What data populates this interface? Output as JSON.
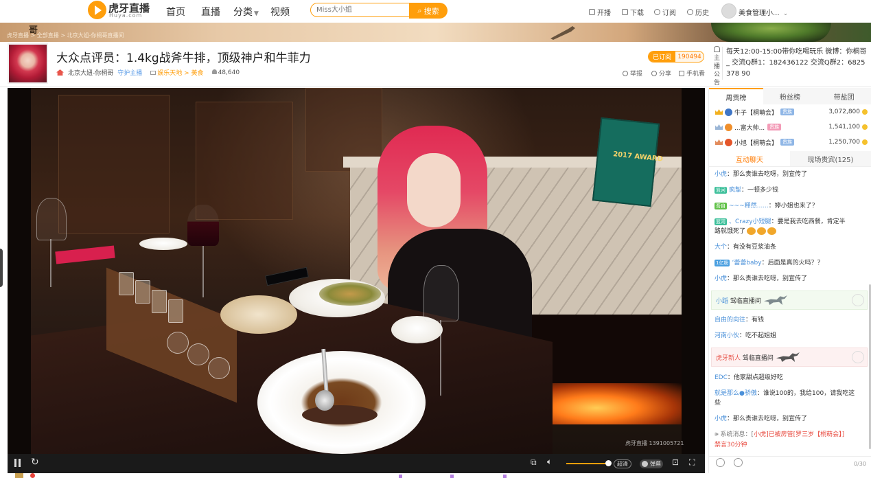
{
  "header": {
    "logo": {
      "cn": "虎牙直播",
      "en": "Huya.com"
    },
    "nav": [
      {
        "label": "首页"
      },
      {
        "label": "直播"
      },
      {
        "label": "分类"
      },
      {
        "label": "视频"
      }
    ],
    "search": {
      "placeholder": "Miss大小姐",
      "button": "搜索"
    },
    "right_links": [
      {
        "label": "开播",
        "icon": "broadcast-icon"
      },
      {
        "label": "下载",
        "icon": "download-icon"
      },
      {
        "label": "订阅",
        "icon": "heart-icon"
      },
      {
        "label": "历史",
        "icon": "clock-icon"
      }
    ],
    "user": {
      "name": "美食管理小..."
    }
  },
  "banner": {
    "title": "哥",
    "breadcrumb": "虎牙直播 > 全部直播 > 北京大姐-你桐哥直播间"
  },
  "room": {
    "title": "大众点评员：1.4kg战斧牛排，顶级神户和牛菲力",
    "streamer": "北京大妞-你桐哥",
    "guard": "守护主播",
    "category_prefix": "娱乐天地 >",
    "category": "美食",
    "viewers": "48,640",
    "follow": {
      "label": "已订阅",
      "count": "190494"
    },
    "actions": [
      {
        "label": "举报"
      },
      {
        "label": "分享"
      },
      {
        "label": "手机看"
      }
    ]
  },
  "notice": {
    "label": "主播公告",
    "text": "每天12:00-15:00带你吃喝玩乐 微博：你桐哥_ 交流Q群1：182436122 交流Q群2：6825378 90"
  },
  "player": {
    "watermark": "虎牙直播 1391005721",
    "quality": "超清",
    "danmu": "弹幕",
    "award_text": "2017 AWARD"
  },
  "rank": {
    "tabs": [
      "周贡榜",
      "粉丝榜",
      "带盐团"
    ],
    "rows": [
      {
        "name": "牛子【桐萌会】",
        "badge": "贵族",
        "score": "3,072,800"
      },
      {
        "name": "...富大帅...",
        "badge": "贵族",
        "score": "1,541,100"
      },
      {
        "name": "小旭【桐萌会】",
        "badge": "贵族",
        "score": "1,250,700"
      }
    ]
  },
  "chat": {
    "tabs": [
      "互动聊天",
      "现场贵宾(125)"
    ],
    "messages": [
      {
        "fan": "",
        "user": "小虎",
        "text": "：那么贵谁去吃呀，别宣传了"
      },
      {
        "fan": "篮河",
        "user": "疯掣",
        "text": "：一顿多少钱"
      },
      {
        "fan": "吾自",
        "user": "~~~释然......",
        "text": "：婷小姐也来了？"
      },
      {
        "fan": "篮河",
        "user": "、Crazy小短腿",
        "text": "：要是我去吃西餐，肯定半"
      },
      {
        "fan": "",
        "user": "",
        "text": "路就饿死了"
      },
      {
        "fan": "",
        "user": "大个",
        "text": "：有没有豆浆油条"
      },
      {
        "fan": "1亿粉",
        "user": "‘蕾蕾baby",
        "text": "：后面是真的火吗？？"
      },
      {
        "fan": "",
        "user": "小虎",
        "text": "：那么贵谁去吃呀，别宣传了"
      },
      {
        "fan": "",
        "user": "自由的向往",
        "text": "：有钱"
      },
      {
        "fan": "",
        "user": "河南小伙",
        "text": "：吃不起姐姐"
      },
      {
        "fan": "",
        "user": "EDC",
        "text": "：他家甜点超级好吃"
      },
      {
        "fan": "",
        "user": "就是那么●骄傲",
        "text": "：谁说100的，我给100，请我吃这"
      },
      {
        "fan": "",
        "user": "",
        "text": "些"
      },
      {
        "fan": "",
        "user": "小虎",
        "text": "：那么贵谁去吃呀，别宣传了"
      }
    ],
    "entries": [
      {
        "user": "小蹈",
        "text": "驾临直播间"
      },
      {
        "user": "虎牙新人",
        "text": "驾临直播间"
      }
    ],
    "system": {
      "prefix": "系统消息：[",
      "user": "小虎",
      "mid": "]已被房管[",
      "admin": "罗三岁【桐萌会】",
      "suffix": "]",
      "line2": "禁言30分钟"
    },
    "input_count": "0/30"
  },
  "colors": {
    "accent": "#ff9e0b",
    "link": "#4a90d9",
    "system": "#e84a3f"
  }
}
